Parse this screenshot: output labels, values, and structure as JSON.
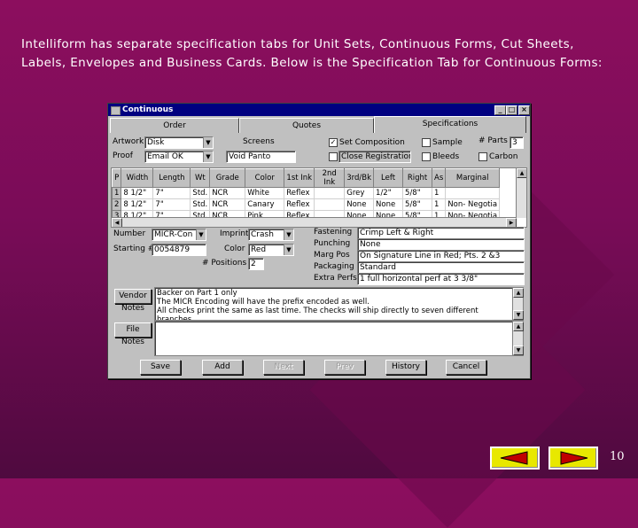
{
  "intro": {
    "line1": "Intelliform has separate specification tabs for Unit Sets, Continuous Forms, Cut Sheets,",
    "line2": "Labels, Envelopes and Business Cards. Below is the Specification Tab for Continuous Forms:"
  },
  "window": {
    "title": "Continuous",
    "tabs": [
      "Order",
      "Quotes",
      "Specifications"
    ],
    "artwork_label": "Artwork",
    "artwork_value": "Disk",
    "proof_label": "Proof",
    "proof_value": "Email OK",
    "screens_label": "Screens",
    "screens_value": "Void Panto",
    "set_composition_label": "Set Composition",
    "set_composition_checked": true,
    "close_registration_label": "Close Registration",
    "close_registration_checked": false,
    "sample_label": "Sample",
    "bleeds_label": "Bleeds",
    "parts_label": "# Parts",
    "parts_value": "3",
    "carbon_label": "Carbon",
    "grid": {
      "headers": [
        "P",
        "Width",
        "Length",
        "Wt",
        "Grade",
        "Color",
        "1st Ink",
        "2nd Ink",
        "3rd/Bk",
        "Left",
        "Right",
        "As",
        "Marginal"
      ],
      "rows": [
        [
          "1",
          "8 1/2\"",
          "7\"",
          "Std.",
          "NCR",
          "White",
          "Reflex",
          "",
          "Grey",
          "1/2\"",
          "5/8\"",
          "1",
          ""
        ],
        [
          "2",
          "8 1/2\"",
          "7\"",
          "Std.",
          "NCR",
          "Canary",
          "Reflex",
          "",
          "None",
          "None",
          "5/8\"",
          "1",
          "Non- Negotia"
        ],
        [
          "3",
          "8 1/2\"",
          "7\"",
          "Std.",
          "NCR",
          "Pink",
          "Reflex",
          "",
          "None",
          "None",
          "5/8\"",
          "1",
          "Non- Negotia"
        ]
      ]
    },
    "number_label": "Number",
    "number_value": "MICR-Con",
    "starting_label": "Starting #",
    "starting_value": "0054879",
    "imprint_label": "Imprint",
    "imprint_value": "Crash",
    "color_label": "Color",
    "color_value": "Red",
    "positions_label": "# Positions",
    "positions_value": "2",
    "fastening_label": "Fastening",
    "fastening_value": "Crimp Left & Right",
    "punching_label": "Punching",
    "punching_value": "None",
    "margpos_label": "Marg Pos",
    "margpos_value": "On Signature Line in Red; Pts. 2 &3",
    "packaging_label": "Packaging",
    "packaging_value": "Standard",
    "extraperfs_label": "Extra Perfs",
    "extraperfs_value": "1 full horizontal perf at 3 3/8\"",
    "vendor_button": "Vendor",
    "vendor_notes_label": "Notes",
    "vendor_notes": [
      "Backer on Part 1 only",
      "The MICR Encoding will have the prefix encoded as well.",
      "All checks print the same as last time. The checks will ship directly to seven different branches."
    ],
    "file_button": "File",
    "file_notes_label": "Notes",
    "buttons": {
      "save": "Save",
      "add": "Add",
      "next": "Next",
      "prev": "Prev",
      "history": "History",
      "cancel": "Cancel"
    }
  },
  "page_number": "10",
  "colors": {
    "background": "#8c0e5e",
    "titlebar": "#000080",
    "nav_button": "#e8e800"
  }
}
